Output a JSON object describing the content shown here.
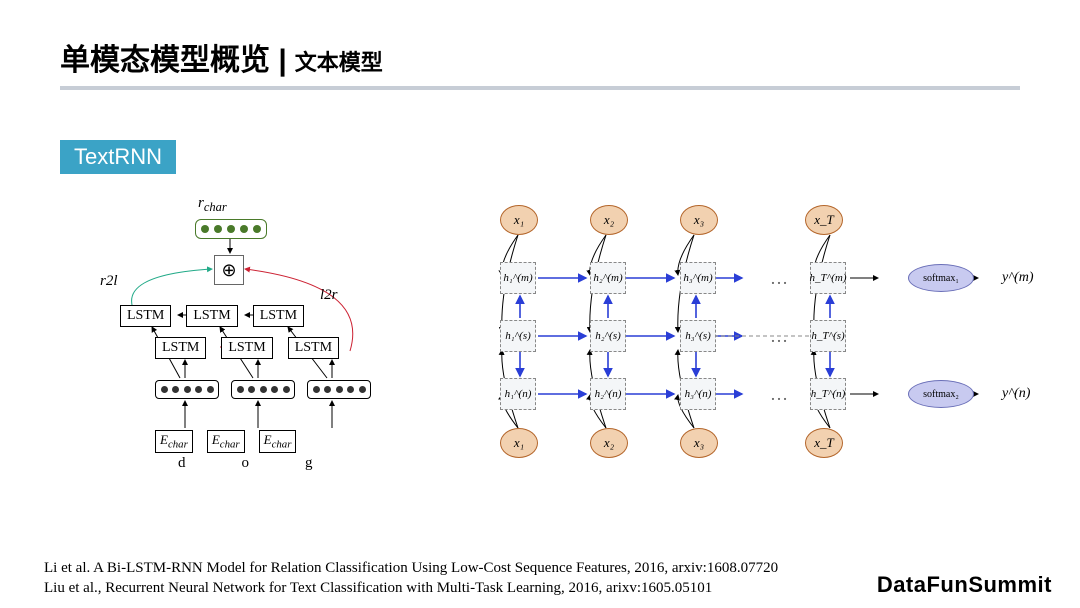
{
  "header": {
    "main": "单模态模型概览 |",
    "sub": "文本模型"
  },
  "badge": "TextRNN",
  "left": {
    "rchar": "r",
    "rchar_sub": "char",
    "op": "⊕",
    "edge_left": "r2l",
    "edge_right": "l2r",
    "lstm": "LSTM",
    "echar": "E",
    "echar_sub": "char",
    "chars": [
      "d",
      "o",
      "g"
    ]
  },
  "right": {
    "x": [
      "x₁",
      "x₂",
      "x₃",
      "x_T"
    ],
    "h_m": [
      "h₁^(m)",
      "h₂^(m)",
      "h₃^(m)",
      "h_T^(m)"
    ],
    "h_s": [
      "h₁^(s)",
      "h₂^(s)",
      "h₃^(s)",
      "h_T^(s)"
    ],
    "h_n": [
      "h₁^(n)",
      "h₂^(n)",
      "h₃^(n)",
      "h_T^(n)"
    ],
    "softmax1": "softmax₁",
    "softmax2": "softmax₂",
    "y1": "y^(m)",
    "y2": "y^(n)",
    "ellipsis": "…"
  },
  "footer": {
    "line1": "Li et al.  A Bi-LSTM-RNN Model for Relation Classification Using Low-Cost Sequence Features, 2016, arxiv:1608.07720",
    "line2": "Liu et al., Recurrent Neural Network for Text Classification with Multi-Task Learning, 2016, arixv:1605.05101"
  },
  "brand": "DataFunSummit"
}
